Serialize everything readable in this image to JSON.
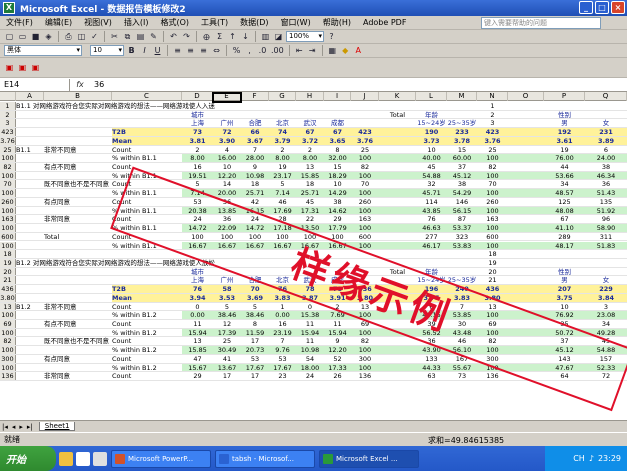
{
  "window": {
    "title": "Microsoft Excel - 数据报告模板修改2"
  },
  "menu": [
    "文件(F)",
    "编辑(E)",
    "视图(V)",
    "插入(I)",
    "格式(O)",
    "工具(T)",
    "数据(D)",
    "窗口(W)",
    "帮助(H)",
    "Adobe PDF"
  ],
  "help_placeholder": "键入需要帮助的问题",
  "toolbar": {
    "zoom": "100%",
    "font": "黑体",
    "font_size": "10"
  },
  "formula": {
    "cell_ref": "E14",
    "fx": "fx",
    "value": "36"
  },
  "columns": [
    "A",
    "B",
    "C",
    "D",
    "E",
    "F",
    "G",
    "H",
    "I",
    "J",
    "K",
    "L",
    "M",
    "N",
    "O",
    "P",
    "Q"
  ],
  "rows": [
    {
      "n": "1",
      "a": "B1.1 对网络游戏符合您实际对网络游戏的想法——网络游戏使人入迷"
    },
    {
      "n": "2",
      "c": "",
      "d": "城市",
      "k": "Total",
      "l": "年龄",
      "p": "性别"
    },
    {
      "n": "3",
      "d": "上海",
      "e": "广州",
      "f": "合肥",
      "g": "北京",
      "h": "武汉",
      "i": "成都",
      "l": "15~24岁",
      "m": "25~35岁",
      "p": "男",
      "q": "女"
    },
    {
      "n": "423",
      "c": "T2B",
      "d": "73",
      "e": "72",
      "f": "66",
      "g": "74",
      "h": "67",
      "i": "67",
      "j": "423",
      "l": "190",
      "m": "233",
      "p": "192",
      "q": "231",
      "cls": "yellowrow"
    },
    {
      "n": "3.76",
      "c": "Mean",
      "d": "3.81",
      "e": "3.90",
      "f": "3.67",
      "g": "3.79",
      "h": "3.72",
      "i": "3.65",
      "j": "3.76",
      "l": "3.73",
      "m": "3.78",
      "p": "3.61",
      "q": "3.89",
      "cls": "yellowrow"
    },
    {
      "n": "25",
      "a": "B1.1",
      "b": "非常不同意",
      "c": "Count",
      "d": "2",
      "e": "4",
      "f": "7",
      "g": "2",
      "h": "2",
      "i": "8",
      "j": "25",
      "l": "10",
      "m": "15",
      "p": "19",
      "q": "6"
    },
    {
      "n": "100",
      "c": "% within B1.1",
      "d": "8.00",
      "e": "16.00",
      "f": "28.00",
      "g": "8.00",
      "h": "8.00",
      "i": "32.00",
      "j": "100",
      "l": "40.00",
      "m": "60.00",
      "p": "76.00",
      "q": "24.00",
      "cls": "greenrow"
    },
    {
      "n": "82",
      "b": "有点不同意",
      "c": "Count",
      "d": "16",
      "e": "10",
      "f": "9",
      "g": "19",
      "h": "13",
      "i": "15",
      "j": "82",
      "l": "45",
      "m": "37",
      "p": "44",
      "q": "38"
    },
    {
      "n": "100",
      "c": "% within B1.1",
      "d": "19.51",
      "e": "12.20",
      "f": "10.98",
      "g": "23.17",
      "h": "15.85",
      "i": "18.29",
      "j": "100",
      "l": "54.88",
      "m": "45.12",
      "p": "53.66",
      "q": "46.34",
      "cls": "greenrow"
    },
    {
      "n": "70",
      "b": "既不同意也不是不同意",
      "c": "Count",
      "d": "5",
      "e": "14",
      "f": "18",
      "g": "5",
      "h": "18",
      "i": "10",
      "j": "70",
      "l": "32",
      "m": "38",
      "p": "34",
      "q": "36"
    },
    {
      "n": "100",
      "c": "% within B1.1",
      "d": "7.14",
      "e": "20.00",
      "f": "25.71",
      "g": "7.14",
      "h": "25.71",
      "i": "14.29",
      "j": "100",
      "l": "45.71",
      "m": "54.29",
      "p": "48.57",
      "q": "51.43",
      "cls": "greenrow"
    },
    {
      "n": "260",
      "b": "有点同意",
      "c": "Count",
      "d": "53",
      "e": "36",
      "f": "42",
      "g": "46",
      "h": "45",
      "i": "38",
      "j": "260",
      "l": "114",
      "m": "146",
      "p": "125",
      "q": "135"
    },
    {
      "n": "100",
      "c": "% within B1.1",
      "d": "20.38",
      "e": "13.85",
      "f": "16.15",
      "g": "17.69",
      "h": "17.31",
      "i": "14.62",
      "j": "100",
      "l": "43.85",
      "m": "56.15",
      "p": "48.08",
      "q": "51.92",
      "cls": "greenrow"
    },
    {
      "n": "163",
      "b": "非常同意",
      "c": "Count",
      "d": "24",
      "e": "36",
      "f": "24",
      "g": "28",
      "h": "22",
      "i": "29",
      "j": "163",
      "l": "76",
      "m": "87",
      "p": "67",
      "q": "96"
    },
    {
      "n": "100",
      "c": "% within B1.1",
      "d": "14.72",
      "e": "22.09",
      "f": "14.72",
      "g": "17.18",
      "h": "13.50",
      "i": "17.79",
      "j": "100",
      "l": "46.63",
      "m": "53.37",
      "p": "41.10",
      "q": "58.90",
      "cls": "greenrow"
    },
    {
      "n": "600",
      "b": "Total",
      "c": "Count",
      "d": "100",
      "e": "100",
      "f": "100",
      "g": "100",
      "h": "100",
      "i": "100",
      "j": "600",
      "l": "277",
      "m": "323",
      "p": "289",
      "q": "311"
    },
    {
      "n": "100",
      "c": "% within B1.1",
      "d": "16.67",
      "e": "16.67",
      "f": "16.67",
      "g": "16.67",
      "h": "16.67",
      "i": "16.67",
      "j": "100",
      "l": "46.17",
      "m": "53.83",
      "p": "48.17",
      "q": "51.83",
      "cls": "greenrow"
    },
    {
      "n": "18"
    },
    {
      "n": "19",
      "a": "B1.2 对网络游戏符合您实际对网络游戏的想法——网络游戏使人放松"
    },
    {
      "n": "20",
      "d": "城市",
      "k": "Total",
      "l": "年龄",
      "p": "性别"
    },
    {
      "n": "21",
      "d": "上海",
      "e": "广州",
      "f": "合肥",
      "g": "北京",
      "h": "武汉",
      "i": "成都",
      "l": "15~24岁",
      "m": "25~35岁",
      "p": "男",
      "q": "女"
    },
    {
      "n": "436",
      "c": "T2B",
      "d": "76",
      "e": "58",
      "f": "70",
      "g": "76",
      "h": "78",
      "i": "78",
      "j": "436",
      "l": "196",
      "m": "240",
      "p": "207",
      "q": "229",
      "cls": "yellowrow"
    },
    {
      "n": "3.80",
      "c": "Mean",
      "d": "3.94",
      "e": "3.53",
      "f": "3.69",
      "g": "3.83",
      "h": "3.87",
      "i": "3.91",
      "j": "3.80",
      "l": "3.75",
      "m": "3.83",
      "p": "3.75",
      "q": "3.84",
      "cls": "yellowrow"
    },
    {
      "n": "13",
      "a": "B1.2",
      "b": "非常不同意",
      "c": "Count",
      "d": "0",
      "e": "5",
      "f": "5",
      "g": "1",
      "h": "0",
      "i": "2",
      "j": "13",
      "l": "6",
      "m": "7",
      "p": "10",
      "q": "3"
    },
    {
      "n": "100",
      "c": "% within B1.2",
      "d": "0.00",
      "e": "38.46",
      "f": "38.46",
      "g": "0.00",
      "h": "15.38",
      "i": "7.69",
      "j": "100",
      "l": "46.15",
      "m": "53.85",
      "p": "76.92",
      "q": "23.08",
      "cls": "greenrow"
    },
    {
      "n": "69",
      "b": "有点不同意",
      "c": "Count",
      "d": "11",
      "e": "12",
      "f": "8",
      "g": "16",
      "h": "11",
      "i": "11",
      "j": "69",
      "l": "39",
      "m": "30",
      "p": "35",
      "q": "34"
    },
    {
      "n": "100",
      "c": "% within B1.2",
      "d": "15.94",
      "e": "17.39",
      "f": "11.59",
      "g": "23.19",
      "h": "15.94",
      "i": "15.94",
      "j": "100",
      "l": "56.52",
      "m": "43.48",
      "p": "50.72",
      "q": "49.28",
      "cls": "greenrow"
    },
    {
      "n": "82",
      "b": "既不同意也不是不同意",
      "c": "Count",
      "d": "13",
      "e": "25",
      "f": "17",
      "g": "7",
      "h": "11",
      "i": "9",
      "j": "82",
      "l": "36",
      "m": "46",
      "p": "37",
      "q": "45"
    },
    {
      "n": "100",
      "c": "% within B1.2",
      "d": "15.85",
      "e": "30.49",
      "f": "20.73",
      "g": "9.76",
      "h": "10.98",
      "i": "12.20",
      "j": "100",
      "l": "43.90",
      "m": "56.10",
      "p": "45.12",
      "q": "54.88",
      "cls": "greenrow"
    },
    {
      "n": "300",
      "b": "有点同意",
      "c": "Count",
      "d": "47",
      "e": "41",
      "f": "53",
      "g": "53",
      "h": "54",
      "i": "52",
      "j": "300",
      "l": "133",
      "m": "167",
      "p": "143",
      "q": "157"
    },
    {
      "n": "100",
      "c": "% within B1.2",
      "d": "15.67",
      "e": "13.67",
      "f": "17.67",
      "g": "17.67",
      "h": "18.00",
      "i": "17.33",
      "j": "100",
      "l": "44.33",
      "m": "55.67",
      "p": "47.67",
      "q": "52.33",
      "cls": "greenrow"
    },
    {
      "n": "136",
      "b": "非常同意",
      "c": "Count",
      "d": "29",
      "e": "17",
      "f": "17",
      "g": "23",
      "h": "24",
      "i": "26",
      "j": "136",
      "l": "63",
      "m": "73",
      "p": "64",
      "q": "72"
    }
  ],
  "watermark": "样缘示例",
  "sheet_tab": "Sheet1",
  "status": {
    "ready": "就绪",
    "sum": "求和=49.84615385"
  },
  "taskbar": {
    "start": "开始",
    "tasks": [
      "Microsoft PowerP...",
      "tabsh - Microsof...",
      "Microsoft Excel ..."
    ],
    "clock": "23:29"
  },
  "colors": {
    "title": "#1f4fb5",
    "green_row": "#ccf2cc",
    "yellow": "#fff29a",
    "watermark": "#e0102a"
  }
}
